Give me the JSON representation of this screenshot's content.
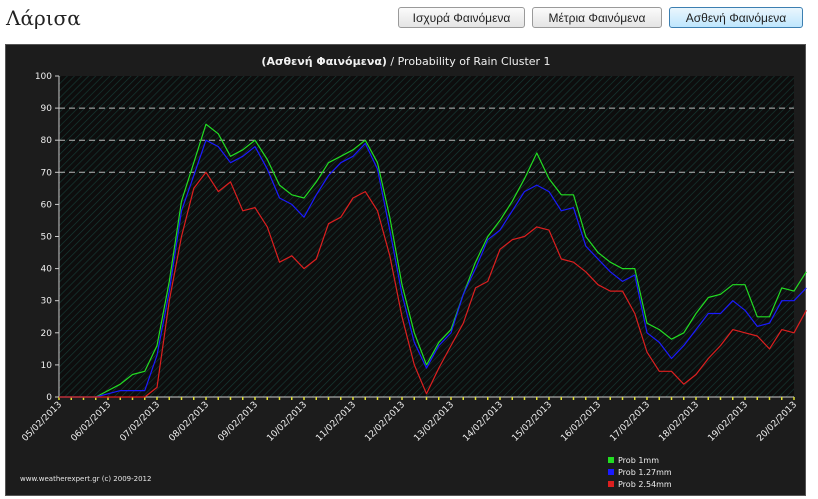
{
  "page": {
    "city": "Λάρισα"
  },
  "buttons": [
    {
      "label": "Ισχυρά Φαινόμενα",
      "active": false
    },
    {
      "label": "Μέτρια Φαινόμενα",
      "active": false
    },
    {
      "label": "Ασθενή Φαινόμενα",
      "active": true
    }
  ],
  "footer": {
    "copyright": "www.weatherexpert.gr (c) 2009-2012"
  },
  "chart_data": {
    "type": "line",
    "title_bold": "(Ασθενή Φαινόμενα)",
    "title_rest": " / Probability of Rain Cluster 1",
    "xlabel": "",
    "ylabel": "",
    "ylim": [
      0,
      100
    ],
    "yticks": [
      0,
      10,
      20,
      30,
      40,
      50,
      60,
      70,
      80,
      90,
      100
    ],
    "dashed_gridlines_at": [
      70,
      80,
      90
    ],
    "xlabels": [
      "05/02/2013",
      "06/02/2013",
      "07/02/2013",
      "08/02/2013",
      "09/02/2013",
      "10/02/2013",
      "11/02/2013",
      "12/02/2013",
      "13/02/2013",
      "14/02/2013",
      "15/02/2013",
      "16/02/2013",
      "17/02/2013",
      "18/02/2013",
      "19/02/2013",
      "20/02/2013"
    ],
    "steps_per_day": 4,
    "series": [
      {
        "name": "Prob 1mm",
        "color": "#22dd22",
        "values": [
          0,
          0,
          0,
          0,
          2,
          4,
          7,
          8,
          16,
          36,
          61,
          73,
          85,
          82,
          75,
          77,
          80,
          74,
          66,
          63,
          62,
          67,
          73,
          75,
          77,
          80,
          73,
          56,
          35,
          20,
          10,
          17,
          21,
          32,
          42,
          50,
          55,
          61,
          68,
          76,
          68,
          63,
          63,
          50,
          45,
          42,
          40,
          40,
          23,
          21,
          18,
          20,
          26,
          31,
          32,
          35,
          35,
          25,
          25,
          34,
          33,
          39
        ]
      },
      {
        "name": "Prob 1.27mm",
        "color": "#1a1aff",
        "values": [
          0,
          0,
          0,
          0,
          1,
          2,
          2,
          2,
          13,
          33,
          58,
          69,
          80,
          78,
          73,
          75,
          78,
          71,
          62,
          60,
          56,
          63,
          69,
          73,
          75,
          79,
          71,
          52,
          32,
          17,
          9,
          16,
          20,
          32,
          40,
          49,
          52,
          58,
          64,
          66,
          64,
          58,
          59,
          47,
          43,
          39,
          36,
          38,
          20,
          17,
          12,
          16,
          21,
          26,
          26,
          30,
          27,
          22,
          23,
          30,
          30,
          34
        ]
      },
      {
        "name": "Prob 2.54mm",
        "color": "#dd1f1f",
        "values": [
          0,
          0,
          0,
          0,
          0,
          0,
          0,
          0,
          3,
          30,
          50,
          65,
          70,
          64,
          67,
          58,
          59,
          53,
          42,
          44,
          40,
          43,
          54,
          56,
          62,
          64,
          58,
          44,
          25,
          10,
          1,
          9,
          16,
          23,
          34,
          36,
          46,
          49,
          50,
          53,
          52,
          43,
          42,
          39,
          35,
          33,
          33,
          26,
          14,
          8,
          8,
          4,
          7,
          12,
          16,
          21,
          20,
          19,
          15,
          21,
          20,
          27
        ]
      }
    ]
  }
}
